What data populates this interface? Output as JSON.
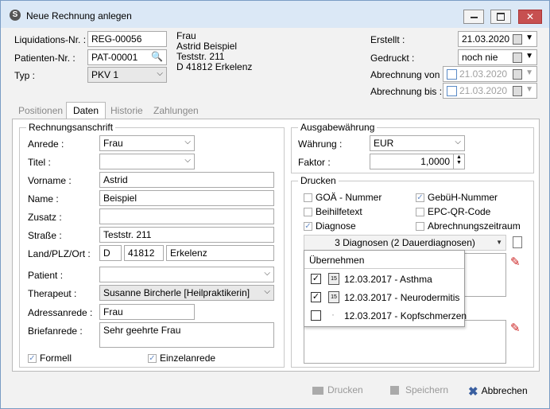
{
  "window": {
    "title": "Neue Rechnung anlegen"
  },
  "header": {
    "liq_label": "Liquidations-Nr. :",
    "liq_value": "REG-00056",
    "pat_label": "Patienten-Nr. :",
    "pat_value": "PAT-00001",
    "typ_label": "Typ :",
    "typ_value": "PKV 1",
    "address": [
      "Frau",
      "Astrid Beispiel",
      "Teststr. 211",
      "D 41812 Erkelenz"
    ],
    "erstellt_label": "Erstellt :",
    "erstellt_value": "21.03.2020",
    "gedruckt_label": "Gedruckt :",
    "gedruckt_value": "noch nie",
    "von_label": "Abrechnung von :",
    "von_value": "21.03.2020",
    "bis_label": "Abrechnung bis :",
    "bis_value": "21.03.2020"
  },
  "tabs": [
    "Positionen",
    "Daten",
    "Historie",
    "Zahlungen"
  ],
  "rechnungsanschrift": {
    "title": "Rechnungsanschrift",
    "anrede_label": "Anrede :",
    "anrede_value": "Frau",
    "titel_label": "Titel :",
    "titel_value": "",
    "vorname_label": "Vorname :",
    "vorname_value": "Astrid",
    "name_label": "Name :",
    "name_value": "Beispiel",
    "zusatz_label": "Zusatz :",
    "zusatz_value": "",
    "strasse_label": "Straße :",
    "strasse_value": "Teststr. 211",
    "land_label": "Land/PLZ/Ort :",
    "land_value": "D",
    "plz_value": "41812",
    "ort_value": "Erkelenz",
    "patient_label": "Patient :",
    "patient_value": "",
    "therapeut_label": "Therapeut :",
    "therapeut_value": "Susanne Bircherle [Heilpraktikerin]",
    "adressanrede_label": "Adressanrede :",
    "adressanrede_value": "Frau",
    "briefanrede_label": "Briefanrede :",
    "briefanrede_value": "Sehr geehrte Frau",
    "formell_label": "Formell",
    "formell_checked": true,
    "einzelanrede_label": "Einzelanrede",
    "einzelanrede_checked": true
  },
  "ausgabewaehrung": {
    "title": "Ausgabewährung",
    "waehrung_label": "Währung :",
    "waehrung_value": "EUR",
    "faktor_label": "Faktor :",
    "faktor_value": "1,0000"
  },
  "drucken_group": {
    "title": "Drucken",
    "goa_label": "GOÄ - Nummer",
    "goa_checked": false,
    "gebueh_label": "GebüH-Nummer",
    "gebueh_checked": true,
    "beihilfe_label": "Beihilfetext",
    "beihilfe_checked": false,
    "epc_label": "EPC-QR-Code",
    "epc_checked": false,
    "diagnose_label": "Diagnose",
    "diagnose_checked": true,
    "zeitraum_label": "Abrechnungszeitraum",
    "zeitraum_checked": false,
    "diagnosen_select": "3 Diagnosen (2 Dauerdiagnosen)"
  },
  "popup": {
    "header": "Übernehmen",
    "items": [
      {
        "label": "12.03.2017 - Asthma",
        "checked": true,
        "icon": "calendar-dauer-icon"
      },
      {
        "label": "12.03.2017 - Neurodermitis",
        "checked": true,
        "icon": "calendar-dauer-icon"
      },
      {
        "label": "12.03.2017 - Kopfschmerzen",
        "checked": false,
        "icon": "dot-icon"
      }
    ]
  },
  "footer": {
    "drucken": "Drucken",
    "speichern": "Speichern",
    "abbrechen": "Abbrechen"
  }
}
